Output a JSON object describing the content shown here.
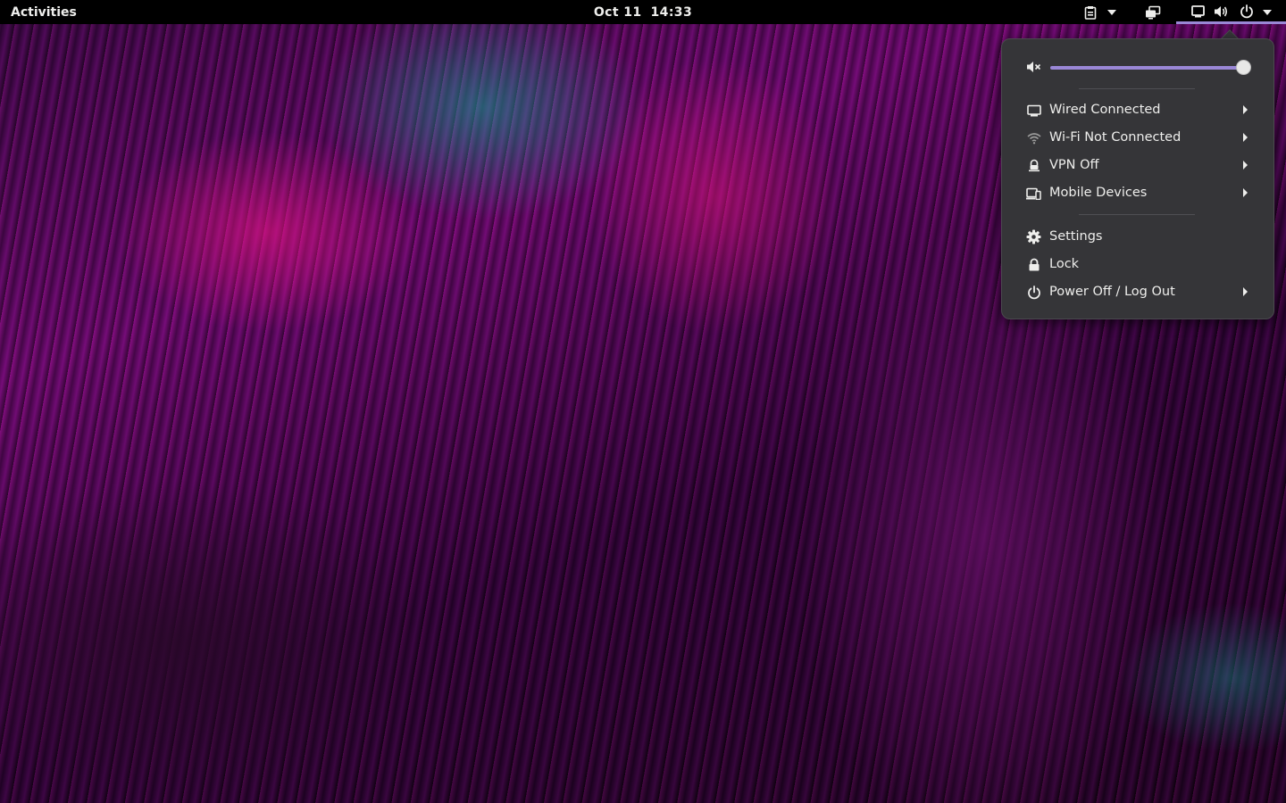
{
  "topbar": {
    "activities_label": "Activities",
    "clock_date": "Oct 11",
    "clock_time": "14:33",
    "icons": [
      "clipboard-icon",
      "dropdown-arrow-icon",
      "display-icon",
      "network-wired-icon",
      "volume-icon",
      "power-icon",
      "dropdown-arrow-icon"
    ]
  },
  "system_menu": {
    "volume": {
      "level": 1.0,
      "icon": "volume-muted-icon"
    },
    "network": [
      {
        "label": "Wired Connected",
        "icon": "wired-icon"
      },
      {
        "label": "Wi-Fi Not Connected",
        "icon": "wifi-icon"
      },
      {
        "label": "VPN Off",
        "icon": "vpn-icon"
      },
      {
        "label": "Mobile Devices",
        "icon": "mobile-devices-icon"
      }
    ],
    "actions": [
      {
        "label": "Settings",
        "icon": "gear-icon"
      },
      {
        "label": "Lock",
        "icon": "lock-icon"
      },
      {
        "label": "Power Off / Log Out",
        "icon": "power-icon"
      }
    ]
  },
  "colors": {
    "topbar_bg": "#000000",
    "menu_bg": "#353538",
    "accent": "#9a87d6",
    "text": "#eeeeec"
  }
}
